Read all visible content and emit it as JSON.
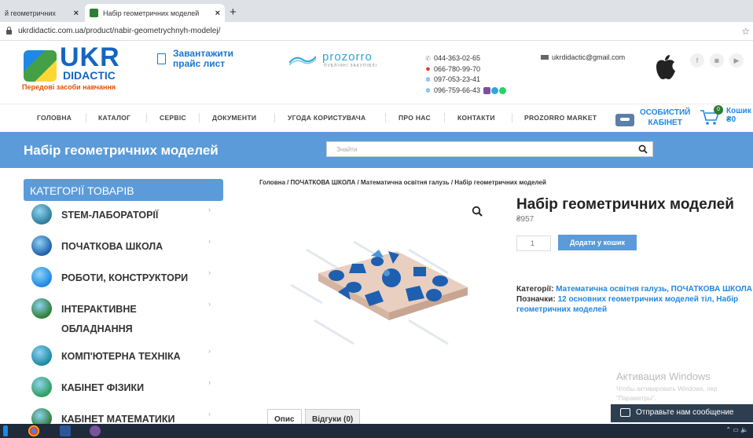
{
  "browser": {
    "tabs": [
      {
        "label": "й геометричних"
      },
      {
        "label": "Набір геометричних моделей"
      }
    ],
    "new_tab": "+",
    "url": "ukrdidactic.com.ua/product/nabir-geometrychnyh-modelej/"
  },
  "header": {
    "logo_main": "UKR",
    "logo_sub": "DIDACTIC",
    "logo_tagline": "Передові засоби навчання",
    "price_list": [
      "Завантажити",
      "прайс лист"
    ],
    "prozorro_name": "prozorro",
    "prozorro_sub": "ПУБЛІЧНІ ЗАКУПІВЛІ",
    "phones": [
      "044-363-02-65",
      "066-780-99-70",
      "097-053-23-41",
      "096-759-66-43"
    ],
    "email": "ukrdidactic@gmail.com",
    "social": [
      "f",
      "◙",
      "▶"
    ]
  },
  "nav": {
    "items": [
      "ГОЛОВНА",
      "КАТАЛОГ",
      "СЕРВІС",
      "ДОКУМЕНТИ",
      "УГОДА КОРИСТУВАЧА",
      "ПРО НАС",
      "КОНТАКТИ",
      "PROZORRO MARKET"
    ],
    "cabinet": [
      "ОСОБИСТИЙ",
      "КАБІНЕТ"
    ],
    "cart_label": "Кошик",
    "cart_sum": "₴0",
    "cart_count": "0"
  },
  "band": {
    "title": "Набір геометричних моделей",
    "search_placeholder": "Знайти"
  },
  "sidebar": {
    "heading": "КАТЕГОРІЇ ТОВАРІВ",
    "items": [
      {
        "label": "STEM-ЛАБОРАТОРІЇ",
        "color": "#2e7d9a"
      },
      {
        "label": "ПОЧАТКОВА ШКОЛА",
        "color": "#1e5fa8"
      },
      {
        "label": "РОБОТИ, КОНСТРУКТОРИ",
        "color": "#1e88e5"
      },
      {
        "label": "ІНТЕРАКТИВНЕ",
        "label2": "ОБЛАДНАННЯ",
        "color": "#2e7d32"
      },
      {
        "label": "КОМП'ЮТЕРНА ТЕХНІКА",
        "color": "#1b8aa0"
      },
      {
        "label": "КАБІНЕТ ФІЗИКИ",
        "color": "#2e9e5b"
      },
      {
        "label": "КАБІНЕТ МАТЕМАТИКИ",
        "color": "#2e7d32"
      }
    ]
  },
  "product": {
    "breadcrumb": "Головна / ПОЧАТКОВА ШКОЛА / Математична освітня галузь / Набір геометричних моделей",
    "title": "Набір геометричних моделей",
    "sku": "₴957",
    "qty": "1",
    "add_to_cart": "Додати у кошик",
    "categories_label": "Категорії:",
    "categories_value": "Математична освітня галузь, ПОЧАТКОВА ШКОЛА",
    "tags_label": "Позначки:",
    "tags_value": "12 основних геометричних моделей тіл, Набір геометричних моделей",
    "tabs": [
      "Опис",
      "Відгуки (0)"
    ]
  },
  "overlay": {
    "activate_title": "Активация Windows",
    "activate_text": [
      "Чтобы активировать Windows, пер",
      "\"Параметры\"."
    ],
    "chat": "Отправьте нам сообщение"
  }
}
